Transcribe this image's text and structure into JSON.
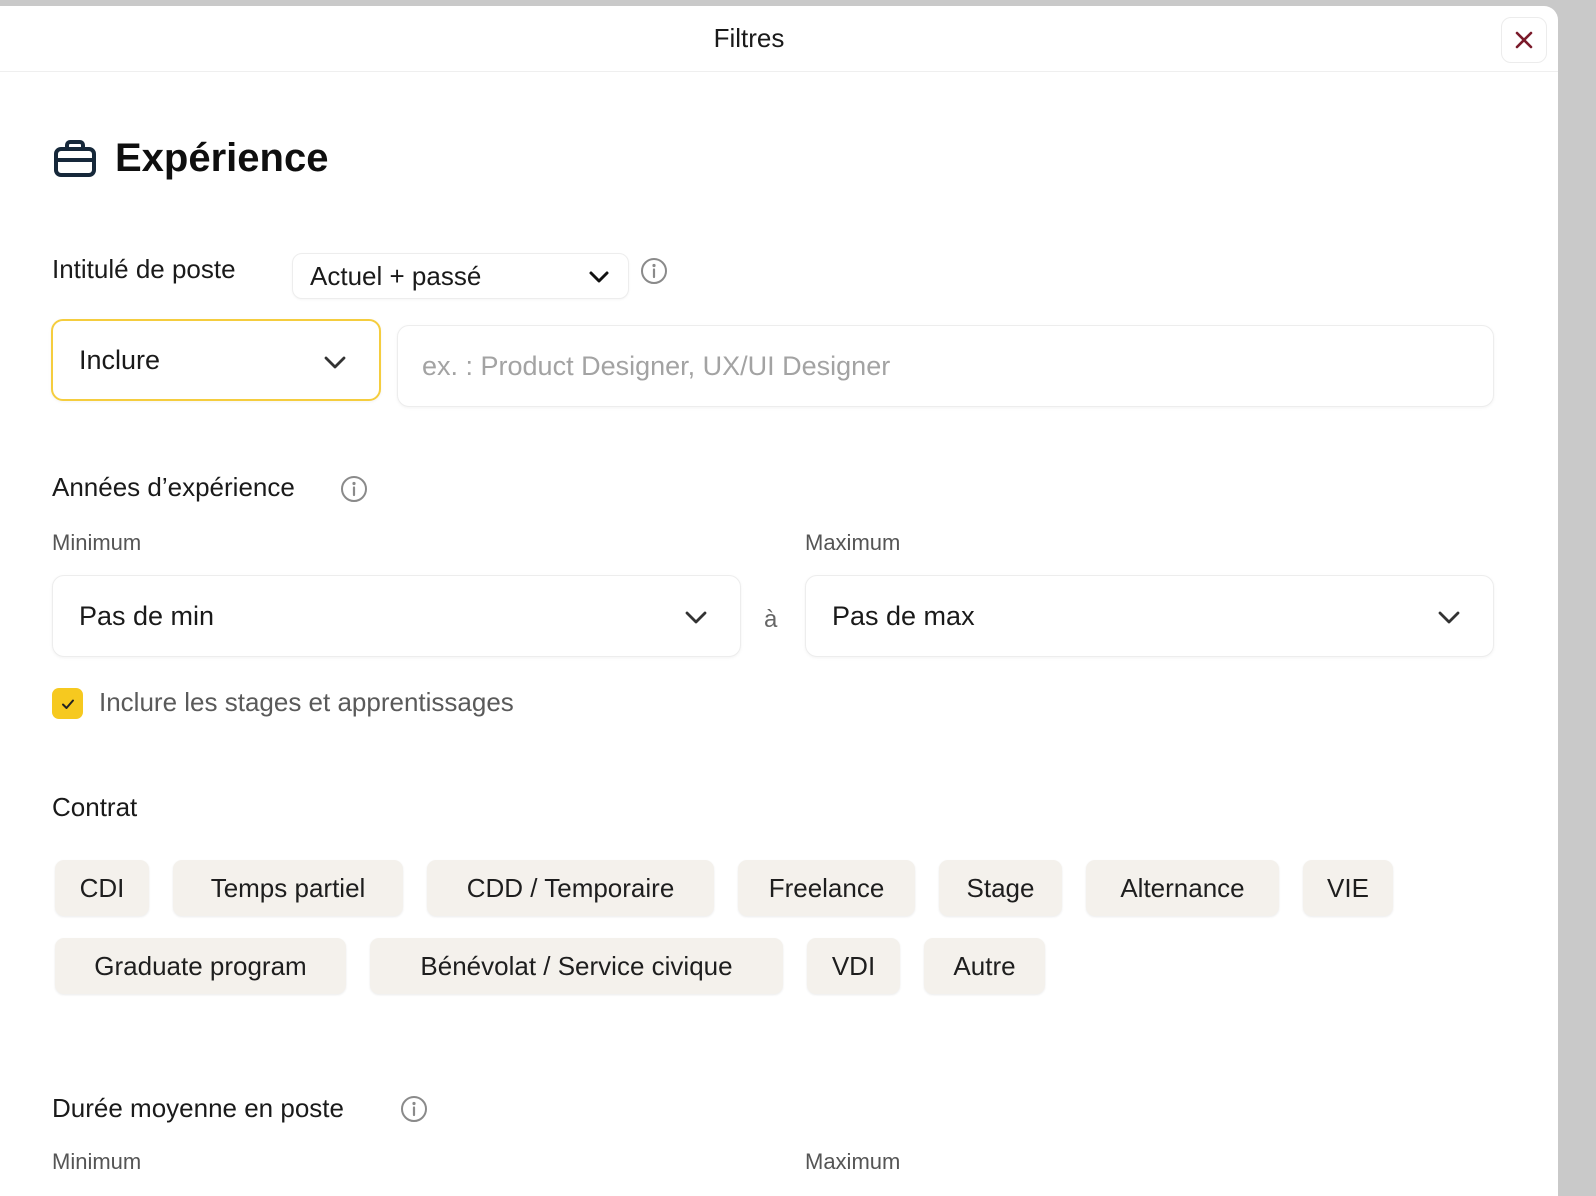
{
  "header": {
    "title": "Filtres"
  },
  "section": {
    "title": "Expérience"
  },
  "job_title": {
    "label": "Intitulé de poste",
    "scope_value": "Actuel + passé",
    "mode_value": "Inclure",
    "placeholder": "ex. : Product Designer, UX/UI Designer"
  },
  "experience_years": {
    "label": "Années d’expérience",
    "min_label": "Minimum",
    "max_label": "Maximum",
    "min_value": "Pas de min",
    "max_value": "Pas de max",
    "separator": "à",
    "include_internships": {
      "label": "Inclure les stages et apprentissages",
      "checked": true
    }
  },
  "contract": {
    "label": "Contrat",
    "chips": [
      "CDI",
      "Temps partiel",
      "CDD / Temporaire",
      "Freelance",
      "Stage",
      "Alternance",
      "VIE",
      "Graduate program",
      "Bénévolat / Service civique",
      "VDI",
      "Autre"
    ]
  },
  "avg_tenure": {
    "label": "Durée moyenne en poste",
    "min_label": "Minimum",
    "max_label": "Maximum"
  },
  "colors": {
    "accent": "#f6c91f",
    "active_border": "#f5cd3e",
    "close_icon": "#7a1a2a",
    "chip_bg": "#f4f1ec"
  },
  "icons": [
    "close-icon",
    "briefcase-icon",
    "chevron-down-icon",
    "info-icon",
    "check-icon"
  ]
}
